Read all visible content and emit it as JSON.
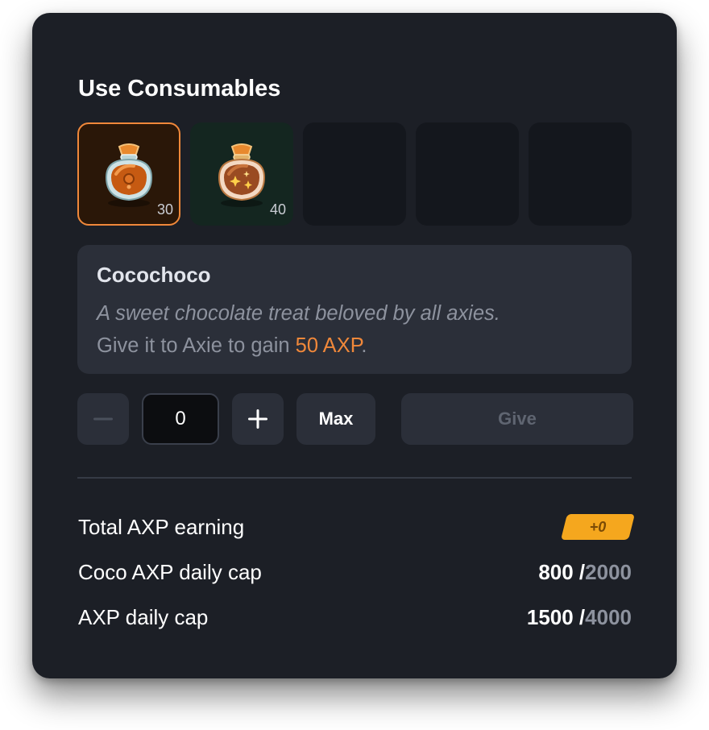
{
  "dialog": {
    "title": "Use Consumables"
  },
  "slots": [
    {
      "item": "cocochoco",
      "count": "30",
      "selected": true
    },
    {
      "item": "sparkle-bag",
      "count": "40",
      "selected": false
    },
    {
      "item": "",
      "count": "",
      "selected": false
    },
    {
      "item": "",
      "count": "",
      "selected": false
    },
    {
      "item": "",
      "count": "",
      "selected": false
    }
  ],
  "description": {
    "name": "Cocochoco",
    "flavor": "A sweet chocolate treat beloved by all axies.",
    "give_prefix": "Give it to Axie to gain ",
    "give_amount": "50 AXP",
    "give_suffix": "."
  },
  "controls": {
    "quantity": "0",
    "max_label": "Max",
    "give_label": "Give",
    "minus_icon": "minus-icon",
    "plus_icon": "plus-icon"
  },
  "stats": {
    "total_label": "Total AXP earning",
    "total_value": "+0",
    "coco_label": "Coco AXP daily cap",
    "coco_current": "800 /",
    "coco_max": "2000",
    "axp_label": "AXP daily cap",
    "axp_current": "1500 /",
    "axp_max": "4000"
  },
  "colors": {
    "panel": "#1c1f26",
    "accent_orange": "#f0883a",
    "badge_yellow": "#f5a71e"
  }
}
